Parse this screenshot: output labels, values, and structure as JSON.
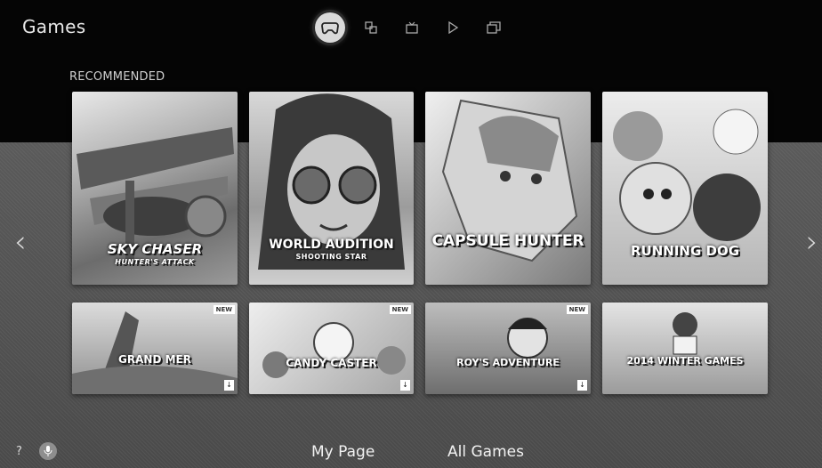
{
  "header": {
    "title": "Games",
    "nav": [
      {
        "icon": "gamepad-icon",
        "glyph": "◙",
        "active": true
      },
      {
        "icon": "apps-icon",
        "glyph": "⧉",
        "active": false
      },
      {
        "icon": "tv-icon",
        "glyph": "⌷",
        "active": false
      },
      {
        "icon": "play-icon",
        "glyph": "▷",
        "active": false
      },
      {
        "icon": "multi-screen-icon",
        "glyph": "⧈",
        "active": false
      }
    ]
  },
  "section": {
    "label": "RECOMMENDED"
  },
  "tiles_large": [
    {
      "title": "SKY CHASER",
      "subtitle": "HUNTER'S ATTACK"
    },
    {
      "title": "WORLD AUDITION",
      "subtitle": "SHOOTING STAR"
    },
    {
      "title": "CAPSULE HUNTER",
      "subtitle": ""
    },
    {
      "title": "RUNNING DOG",
      "subtitle": ""
    }
  ],
  "tiles_small": [
    {
      "title": "GRAND MER",
      "badge": "NEW"
    },
    {
      "title": "CANDY CASTER",
      "badge": "NEW"
    },
    {
      "title": "ROY'S ADVENTURE",
      "badge": "NEW"
    },
    {
      "title": "2014 WINTER GAMES",
      "badge": ""
    }
  ],
  "arrows": {
    "left": "‹",
    "right": "›"
  },
  "footer": {
    "help": "?",
    "my_page": "My Page",
    "all_games": "All Games"
  }
}
